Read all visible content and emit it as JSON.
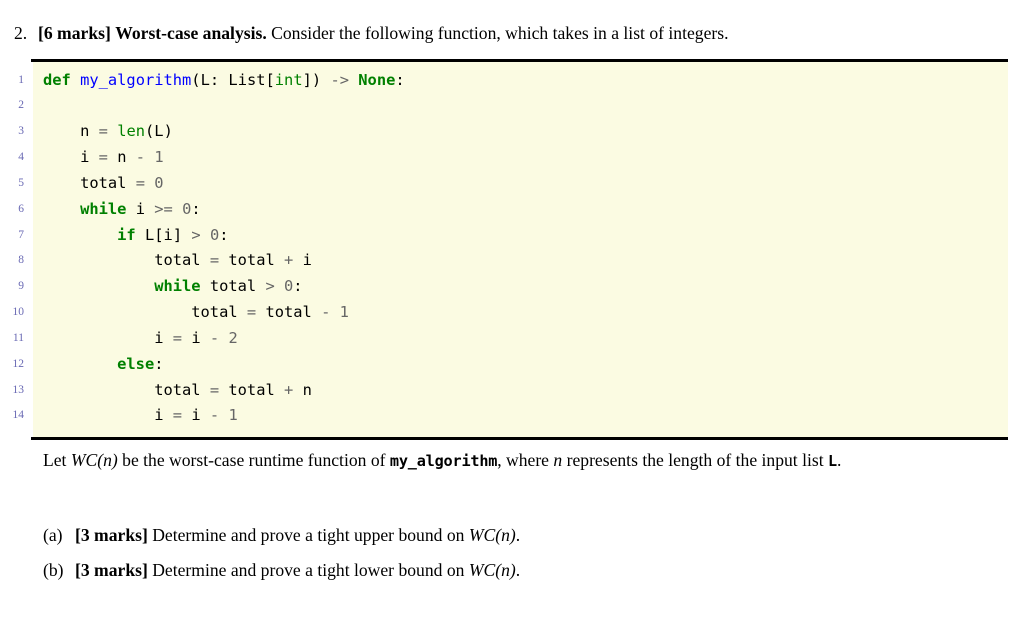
{
  "question": {
    "number": "2.",
    "marks_label": "[6 marks]",
    "title": "Worst-case analysis.",
    "prompt": "Consider the following function, which takes in a list of integers."
  },
  "listing": {
    "language": "python",
    "background_color": "#fbfbe2",
    "linenumber_color": "#6a6ab4",
    "keyword_color": "#008000",
    "function_color": "#0000ff",
    "number_color": "#666666",
    "lines": [
      {
        "no": "1",
        "code": "def my_algorithm(L: List[int]) -> None:"
      },
      {
        "no": "2",
        "code": ""
      },
      {
        "no": "3",
        "code": "    n = len(L)"
      },
      {
        "no": "4",
        "code": "    i = n - 1"
      },
      {
        "no": "5",
        "code": "    total = 0"
      },
      {
        "no": "6",
        "code": "    while i >= 0:"
      },
      {
        "no": "7",
        "code": "        if L[i] > 0:"
      },
      {
        "no": "8",
        "code": "            total = total + i"
      },
      {
        "no": "9",
        "code": "            while total > 0:"
      },
      {
        "no": "10",
        "code": "                total = total - 1"
      },
      {
        "no": "11",
        "code": "            i = i - 2"
      },
      {
        "no": "12",
        "code": "        else:"
      },
      {
        "no": "13",
        "code": "            total = total + n"
      },
      {
        "no": "14",
        "code": "            i = i - 1"
      }
    ]
  },
  "paragraph": {
    "part1": "Let ",
    "math1": "WC(n)",
    "part2": " be the worst-case runtime function of ",
    "code1": "my_algorithm",
    "part3": ", where ",
    "math2": "n",
    "part4": " represents the length of the input list ",
    "code2": "L",
    "part5": "."
  },
  "subparts": [
    {
      "label": "(a)",
      "marks": "[3 marks]",
      "text_before": " Determine and prove a tight upper bound on ",
      "math": "WC(n)",
      "text_after": "."
    },
    {
      "label": "(b)",
      "marks": "[3 marks]",
      "text_before": " Determine and prove a tight lower bound on ",
      "math": "WC(n)",
      "text_after": "."
    }
  ]
}
